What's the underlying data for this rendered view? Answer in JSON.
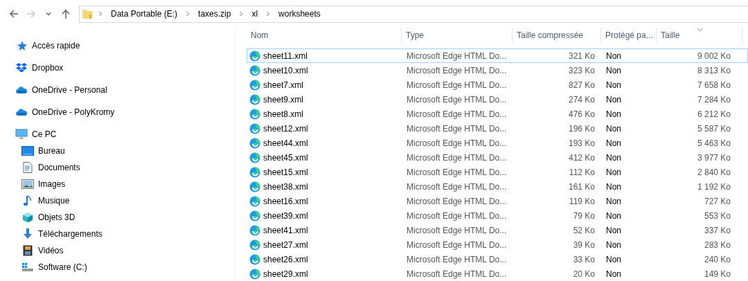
{
  "navigation": [
    {
      "kind": "back",
      "disabled": false
    },
    {
      "kind": "forward",
      "disabled": true
    },
    {
      "kind": "recent",
      "disabled": false
    },
    {
      "kind": "up",
      "disabled": false
    }
  ],
  "breadcrumb": [
    "Data Portable (E:)",
    "taxes.zip",
    "xl",
    "worksheets"
  ],
  "sidebar": {
    "items": [
      {
        "label": "Accès rapide",
        "kind": "star"
      },
      {
        "label": "Dropbox",
        "kind": "dropbox"
      },
      {
        "label": "OneDrive - Personal",
        "kind": "cloud"
      },
      {
        "label": "OneDrive - PolyKromy",
        "kind": "cloud"
      },
      {
        "label": "Ce PC",
        "kind": "pc",
        "children": [
          {
            "label": "Bureau",
            "kind": "desktop"
          },
          {
            "label": "Documents",
            "kind": "documents"
          },
          {
            "label": "Images",
            "kind": "images"
          },
          {
            "label": "Musique",
            "kind": "music"
          },
          {
            "label": "Objets 3D",
            "kind": "cube"
          },
          {
            "label": "Téléchargements",
            "kind": "download"
          },
          {
            "label": "Vidéos",
            "kind": "video"
          },
          {
            "label": "Software (C:)",
            "kind": "drive"
          }
        ]
      }
    ]
  },
  "table": {
    "columns": [
      {
        "label": "Nom",
        "sorted": false
      },
      {
        "label": "Type",
        "sorted": false
      },
      {
        "label": "Taille compressée",
        "sorted": false
      },
      {
        "label": "Protégé pa...",
        "sorted": false
      },
      {
        "label": "Taille",
        "sorted": true
      }
    ],
    "rows": [
      {
        "name": "sheet11.xml",
        "type": "Microsoft Edge HTML Do...",
        "compressed": "321 Ko",
        "protected": "Non",
        "size": "9 002 Ko",
        "focused": true
      },
      {
        "name": "sheet10.xml",
        "type": "Microsoft Edge HTML Do...",
        "compressed": "323 Ko",
        "protected": "Non",
        "size": "8 313 Ko",
        "focused": false
      },
      {
        "name": "sheet7.xml",
        "type": "Microsoft Edge HTML Do...",
        "compressed": "827 Ko",
        "protected": "Non",
        "size": "7 658 Ko",
        "focused": false
      },
      {
        "name": "sheet9.xml",
        "type": "Microsoft Edge HTML Do...",
        "compressed": "274 Ko",
        "protected": "Non",
        "size": "7 284 Ko",
        "focused": false
      },
      {
        "name": "sheet8.xml",
        "type": "Microsoft Edge HTML Do...",
        "compressed": "476 Ko",
        "protected": "Non",
        "size": "6 212 Ko",
        "focused": false
      },
      {
        "name": "sheet12.xml",
        "type": "Microsoft Edge HTML Do...",
        "compressed": "196 Ko",
        "protected": "Non",
        "size": "5 587 Ko",
        "focused": false
      },
      {
        "name": "sheet44.xml",
        "type": "Microsoft Edge HTML Do...",
        "compressed": "193 Ko",
        "protected": "Non",
        "size": "5 463 Ko",
        "focused": false
      },
      {
        "name": "sheet45.xml",
        "type": "Microsoft Edge HTML Do...",
        "compressed": "412 Ko",
        "protected": "Non",
        "size": "3 977 Ko",
        "focused": false
      },
      {
        "name": "sheet15.xml",
        "type": "Microsoft Edge HTML Do...",
        "compressed": "112 Ko",
        "protected": "Non",
        "size": "2 840 Ko",
        "focused": false
      },
      {
        "name": "sheet38.xml",
        "type": "Microsoft Edge HTML Do...",
        "compressed": "161 Ko",
        "protected": "Non",
        "size": "1 192 Ko",
        "focused": false
      },
      {
        "name": "sheet16.xml",
        "type": "Microsoft Edge HTML Do...",
        "compressed": "119 Ko",
        "protected": "Non",
        "size": "727 Ko",
        "focused": false
      },
      {
        "name": "sheet39.xml",
        "type": "Microsoft Edge HTML Do...",
        "compressed": "79 Ko",
        "protected": "Non",
        "size": "553 Ko",
        "focused": false
      },
      {
        "name": "sheet41.xml",
        "type": "Microsoft Edge HTML Do...",
        "compressed": "52 Ko",
        "protected": "Non",
        "size": "337 Ko",
        "focused": false
      },
      {
        "name": "sheet27.xml",
        "type": "Microsoft Edge HTML Do...",
        "compressed": "39 Ko",
        "protected": "Non",
        "size": "283 Ko",
        "focused": false
      },
      {
        "name": "sheet26.xml",
        "type": "Microsoft Edge HTML Do...",
        "compressed": "33 Ko",
        "protected": "Non",
        "size": "240 Ko",
        "focused": false
      },
      {
        "name": "sheet29.xml",
        "type": "Microsoft Edge HTML Do...",
        "compressed": "20 Ko",
        "protected": "Non",
        "size": "149 Ko",
        "focused": false
      }
    ]
  }
}
